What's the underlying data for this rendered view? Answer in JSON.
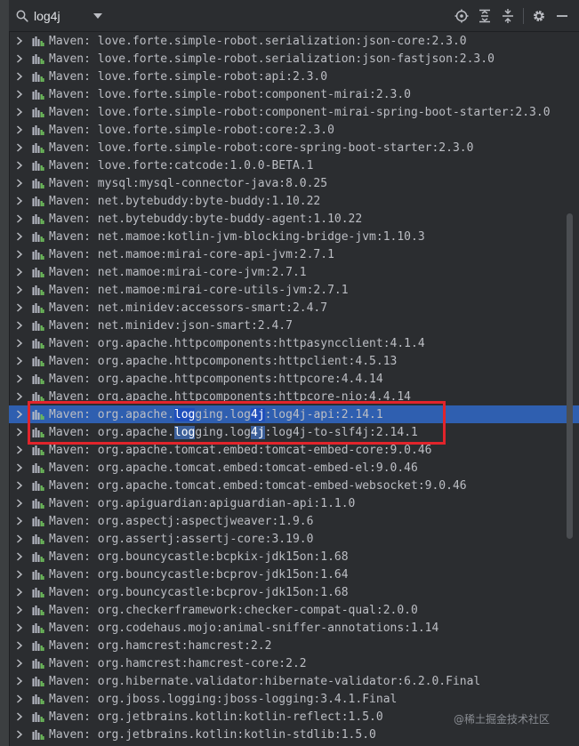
{
  "search": {
    "value": "log4j"
  },
  "toolbar": {
    "icons": [
      "locate-icon",
      "expand-all-icon",
      "collapse-all-icon",
      "gear-icon",
      "minimize-icon"
    ]
  },
  "colors": {
    "background": "#2b2d30",
    "selection": "#2f5fb0",
    "match_highlight": "#1f4fbd",
    "annotation_border": "#e1242b"
  },
  "tree": {
    "rows": [
      {
        "prefix": "Maven: ",
        "text": "love.forte.simple-robot.serialization:json-core:2.3.0"
      },
      {
        "prefix": "Maven: ",
        "text": "love.forte.simple-robot.serialization:json-fastjson:2.3.0"
      },
      {
        "prefix": "Maven: ",
        "text": "love.forte.simple-robot:api:2.3.0"
      },
      {
        "prefix": "Maven: ",
        "text": "love.forte.simple-robot:component-mirai:2.3.0"
      },
      {
        "prefix": "Maven: ",
        "text": "love.forte.simple-robot:component-mirai-spring-boot-starter:2.3.0"
      },
      {
        "prefix": "Maven: ",
        "text": "love.forte.simple-robot:core:2.3.0"
      },
      {
        "prefix": "Maven: ",
        "text": "love.forte.simple-robot:core-spring-boot-starter:2.3.0"
      },
      {
        "prefix": "Maven: ",
        "text": "love.forte:catcode:1.0.0-BETA.1"
      },
      {
        "prefix": "Maven: ",
        "text": "mysql:mysql-connector-java:8.0.25"
      },
      {
        "prefix": "Maven: ",
        "text": "net.bytebuddy:byte-buddy:1.10.22"
      },
      {
        "prefix": "Maven: ",
        "text": "net.bytebuddy:byte-buddy-agent:1.10.22"
      },
      {
        "prefix": "Maven: ",
        "text": "net.mamoe:kotlin-jvm-blocking-bridge-jvm:1.10.3"
      },
      {
        "prefix": "Maven: ",
        "text": "net.mamoe:mirai-core-api-jvm:2.7.1"
      },
      {
        "prefix": "Maven: ",
        "text": "net.mamoe:mirai-core-jvm:2.7.1"
      },
      {
        "prefix": "Maven: ",
        "text": "net.mamoe:mirai-core-utils-jvm:2.7.1"
      },
      {
        "prefix": "Maven: ",
        "text": "net.minidev:accessors-smart:2.4.7"
      },
      {
        "prefix": "Maven: ",
        "text": "net.minidev:json-smart:2.4.7"
      },
      {
        "prefix": "Maven: ",
        "text": "org.apache.httpcomponents:httpasyncclient:4.1.4"
      },
      {
        "prefix": "Maven: ",
        "text": "org.apache.httpcomponents:httpclient:4.5.13"
      },
      {
        "prefix": "Maven: ",
        "text": "org.apache.httpcomponents:httpcore:4.4.14"
      },
      {
        "prefix": "Maven: ",
        "text": "org.apache.httpcomponents:httpcore-nio:4.4.14"
      },
      {
        "prefix": "Maven: ",
        "parts": [
          {
            "t": "org.apache."
          },
          {
            "t": "log",
            "h": 1
          },
          {
            "t": "ging.log"
          },
          {
            "t": "4j",
            "h": 1
          },
          {
            "t": ":log4j-api:2.14.1"
          }
        ],
        "selected": true,
        "focused": true
      },
      {
        "prefix": "Maven: ",
        "parts": [
          {
            "t": "org.apache."
          },
          {
            "t": "log",
            "h": 2
          },
          {
            "t": "ging.log"
          },
          {
            "t": "4j",
            "h": 2
          },
          {
            "t": ":log4j-to-slf4j:2.14.1"
          }
        ],
        "selected": false
      },
      {
        "prefix": "Maven: ",
        "text": "org.apache.tomcat.embed:tomcat-embed-core:9.0.46"
      },
      {
        "prefix": "Maven: ",
        "text": "org.apache.tomcat.embed:tomcat-embed-el:9.0.46"
      },
      {
        "prefix": "Maven: ",
        "text": "org.apache.tomcat.embed:tomcat-embed-websocket:9.0.46"
      },
      {
        "prefix": "Maven: ",
        "text": "org.apiguardian:apiguardian-api:1.1.0"
      },
      {
        "prefix": "Maven: ",
        "text": "org.aspectj:aspectjweaver:1.9.6"
      },
      {
        "prefix": "Maven: ",
        "text": "org.assertj:assertj-core:3.19.0"
      },
      {
        "prefix": "Maven: ",
        "text": "org.bouncycastle:bcpkix-jdk15on:1.68"
      },
      {
        "prefix": "Maven: ",
        "text": "org.bouncycastle:bcprov-jdk15on:1.64"
      },
      {
        "prefix": "Maven: ",
        "text": "org.bouncycastle:bcprov-jdk15on:1.68"
      },
      {
        "prefix": "Maven: ",
        "text": "org.checkerframework:checker-compat-qual:2.0.0"
      },
      {
        "prefix": "Maven: ",
        "text": "org.codehaus.mojo:animal-sniffer-annotations:1.14"
      },
      {
        "prefix": "Maven: ",
        "text": "org.hamcrest:hamcrest:2.2"
      },
      {
        "prefix": "Maven: ",
        "text": "org.hamcrest:hamcrest-core:2.2"
      },
      {
        "prefix": "Maven: ",
        "text": "org.hibernate.validator:hibernate-validator:6.2.0.Final"
      },
      {
        "prefix": "Maven: ",
        "text": "org.jboss.logging:jboss-logging:3.4.1.Final"
      },
      {
        "prefix": "Maven: ",
        "text": "org.jetbrains.kotlin:kotlin-reflect:1.5.0"
      },
      {
        "prefix": "Maven: ",
        "text": "org.jetbrains.kotlin:kotlin-stdlib:1.5.0"
      }
    ]
  },
  "watermark": {
    "text": "@稀土掘金技术社区"
  }
}
